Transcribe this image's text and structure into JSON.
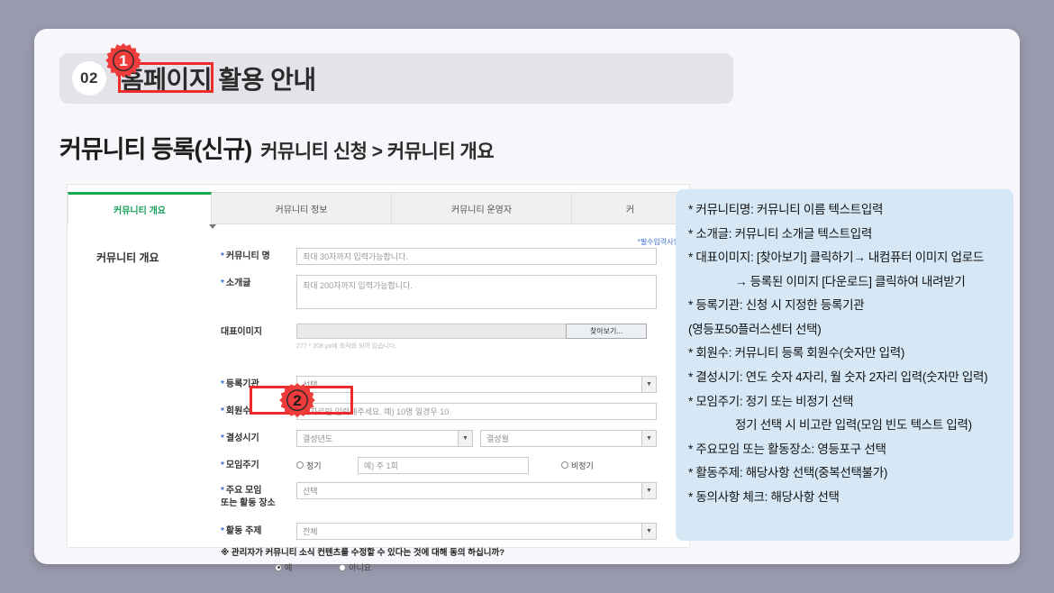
{
  "section": {
    "number": "02",
    "title": "홈페이지 활용 안내"
  },
  "page_title": {
    "main": "커뮤니티 등록(신규)",
    "breadcrumb": "커뮤니티 신청 > 커뮤니티 개요"
  },
  "form": {
    "tabs": [
      {
        "label": "커뮤니티 개요",
        "active": true
      },
      {
        "label": "커뮤니티 정보",
        "active": false
      },
      {
        "label": "커뮤니티 운영자",
        "active": false
      },
      {
        "label": "커",
        "active": false
      }
    ],
    "section_heading": "커뮤니티 개요",
    "required_note": "*필수입력사항",
    "fields": {
      "name_label": "커뮤니티 명",
      "name_placeholder": "최대 30자까지 입력가능합니다.",
      "intro_label": "소개글",
      "intro_placeholder": "최대 200자까지 입력가능합니다.",
      "image_label": "대표이미지",
      "image_button": "찾아보기...",
      "image_hint": "277 * 208 px에 최적화 되어 있습니다.",
      "org_label": "등록기관",
      "org_value": "선택",
      "members_label": "회원수",
      "members_placeholder": "숫자로만 입력해주세요. 예) 10명 일경우 10",
      "founded_label": "결성시기",
      "founded_year": "결성년도",
      "founded_month": "결성월",
      "cycle_label": "모임주기",
      "cycle_regular": "정기",
      "cycle_irregular": "비정기",
      "cycle_placeholder": "예) 주 1회",
      "place_label_line1": "주요 모임",
      "place_label_line2": "또는 활동 장소",
      "place_value": "선택",
      "topic_label": "활동 주제",
      "topic_value": "전체",
      "consent_question": "※ 관리자가 커뮤니티 소식 컨텐츠를 수정할 수 있다는 것에 대해 동의 하십니까?",
      "consent_yes": "예",
      "consent_no": "아니요"
    }
  },
  "markers": {
    "one": "1",
    "two": "2"
  },
  "info_panel": {
    "lines": [
      {
        "text": "* 커뮤니티명: 커뮤니티 이름 텍스트입력",
        "indent": false
      },
      {
        "text": "* 소개글: 커뮤니티 소개글 텍스트입력",
        "indent": false
      },
      {
        "text": "* 대표이미지: [찾아보기] 클릭하기→ 내컴퓨터 이미지 업로드",
        "indent": false
      },
      {
        "text": "→ 등록된 이미지 [다운로드] 클릭하여 내려받기",
        "indent": true
      },
      {
        "text": "* 등록기관: 신청 시 지정한 등록기관",
        "indent": false
      },
      {
        "text": "(영등포50플러스센터 선택)",
        "indent": false
      },
      {
        "text": "* 회원수: 커뮤니티 등록 회원수(숫자만 입력)",
        "indent": false
      },
      {
        "text": "* 결성시기: 연도 숫자 4자리, 월 숫자 2자리 입력(숫자만 입력)",
        "indent": false
      },
      {
        "text": "* 모임주기: 정기 또는 비정기 선택",
        "indent": false
      },
      {
        "text": "정기 선택 시 비고란 입력(모임 빈도 텍스트 입력)",
        "indent": true
      },
      {
        "text": "* 주요모임 또는 활동장소:  영등포구 선택",
        "indent": false
      },
      {
        "text": "* 활동주제: 해당사항 선택(중복선택불가)",
        "indent": false
      },
      {
        "text": "* 동의사항 체크: 해당사항 선택",
        "indent": false
      }
    ]
  },
  "colors": {
    "background": "#9a9aae",
    "card": "#f7f7fb",
    "accent_green": "#13a852",
    "marker_red": "#ec2b2b",
    "info_blue": "#d6e8f5",
    "required_blue": "#3c6fd4"
  }
}
